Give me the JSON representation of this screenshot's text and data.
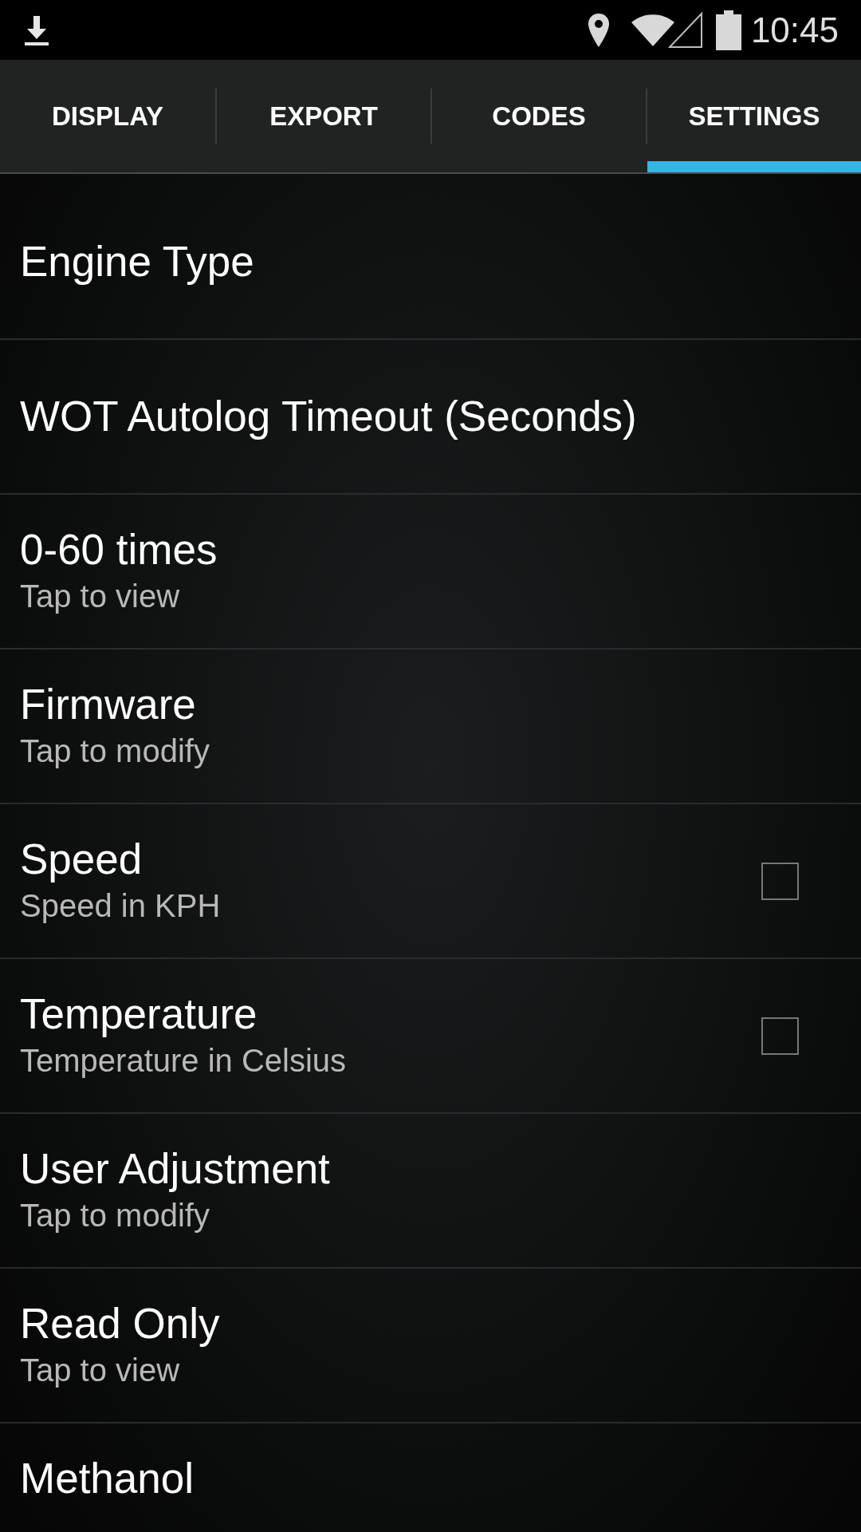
{
  "status_bar": {
    "time": "10:45"
  },
  "tabs": [
    {
      "label": "DISPLAY",
      "selected": false
    },
    {
      "label": "EXPORT",
      "selected": false
    },
    {
      "label": "CODES",
      "selected": false
    },
    {
      "label": "SETTINGS",
      "selected": true
    }
  ],
  "settings": [
    {
      "kind": "plain",
      "title": "Engine Type"
    },
    {
      "kind": "plain",
      "title": "WOT Autolog Timeout (Seconds)"
    },
    {
      "kind": "plain",
      "title": "0-60 times",
      "subtitle": "Tap to view"
    },
    {
      "kind": "plain",
      "title": "Firmware",
      "subtitle": "Tap to modify"
    },
    {
      "kind": "checkbox",
      "title": "Speed",
      "subtitle": "Speed in KPH",
      "checked": false
    },
    {
      "kind": "checkbox",
      "title": "Temperature",
      "subtitle": "Temperature in Celsius",
      "checked": false
    },
    {
      "kind": "plain",
      "title": "User Adjustment",
      "subtitle": "Tap to modify"
    },
    {
      "kind": "plain",
      "title": "Read Only",
      "subtitle": "Tap to view"
    },
    {
      "kind": "plain",
      "title": "Methanol"
    }
  ]
}
